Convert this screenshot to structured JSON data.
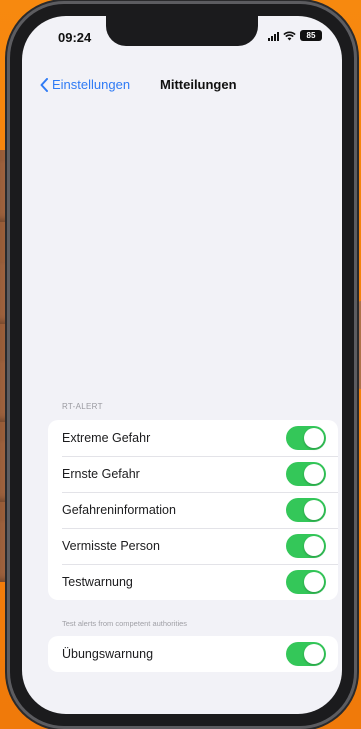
{
  "status_bar": {
    "time": "09:24",
    "battery": "85"
  },
  "nav": {
    "back_label": "Einstellungen",
    "title": "Mitteilungen"
  },
  "alerts": {
    "section_header": "RT-ALERT",
    "items": [
      {
        "label": "Extreme Gefahr",
        "enabled": true
      },
      {
        "label": "Ernste Gefahr",
        "enabled": true
      },
      {
        "label": "Gefahreninformation",
        "enabled": true
      },
      {
        "label": "Vermisste Person",
        "enabled": true
      },
      {
        "label": "Testwarnung",
        "enabled": true
      }
    ],
    "footer": "Test alerts from competent authorities"
  },
  "exercise": {
    "label": "Übungswarnung",
    "enabled": true
  },
  "colors": {
    "background": "#f5820f",
    "accent_blue": "#2f7bf5",
    "toggle_on": "#34c759",
    "screen_bg": "#f2f2f7"
  }
}
